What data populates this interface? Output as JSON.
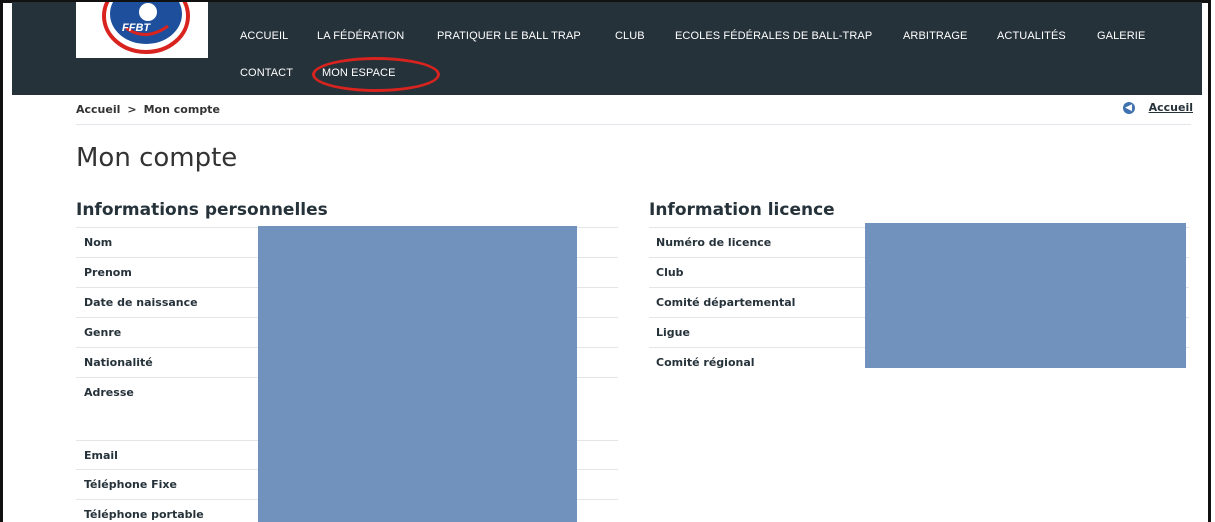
{
  "logo": {
    "text": "FFBT"
  },
  "nav": {
    "row1": [
      "ACCUEIL",
      "LA FÉDÉRATION",
      "PRATIQUER LE BALL TRAP",
      "CLUB",
      "ECOLES FÉDÉRALES DE BALL-TRAP",
      "ARBITRAGE",
      "ACTUALITÉS",
      "GALERIE"
    ],
    "row2": [
      "CONTACT",
      "MON ESPACE"
    ]
  },
  "breadcrumb": {
    "home": "Accueil",
    "separator": ">",
    "current": "Mon compte"
  },
  "back_link": {
    "label": "Accueil"
  },
  "page_title": "Mon compte",
  "personal": {
    "title": "Informations personnelles",
    "fields": [
      "Nom",
      "Prenom",
      "Date de naissance",
      "Genre",
      "Nationalité",
      "Adresse",
      "Email",
      "Téléphone Fixe",
      "Téléphone portable"
    ]
  },
  "licence": {
    "title": "Information licence",
    "fields": [
      "Numéro de licence",
      "Club",
      "Comité départemental",
      "Ligue",
      "Comité régional"
    ]
  },
  "colors": {
    "header": "#26323a",
    "highlight": "#d8231f",
    "redaction": "#7192bd",
    "accent": "#3f72af"
  }
}
